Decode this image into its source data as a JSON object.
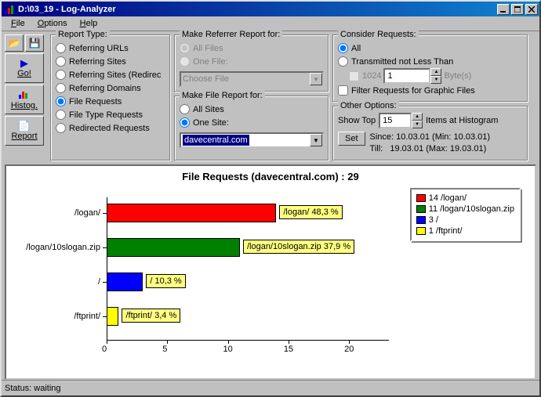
{
  "window": {
    "title": "D:\\03_19 - Log-Analyzer"
  },
  "menu": {
    "file": "File",
    "options": "Options",
    "help": "Help"
  },
  "sidebar": {
    "go": "Go!",
    "histog": "Histog.",
    "report": "Report"
  },
  "report_type": {
    "title": "Report Type:",
    "opts": [
      "Referring URLs",
      "Referring Sites",
      "Referring Sites (Redirec",
      "Referring Domains",
      "File Requests",
      "File Type Requests",
      "Redirected Requests"
    ],
    "selected": 4
  },
  "referrer_report": {
    "title": "Make Referrer Report for:",
    "all_files": "All Files",
    "one_file": "One File:",
    "choose_file": "Choose File"
  },
  "file_report": {
    "title": "Make File Report for:",
    "all_sites": "All Sites",
    "one_site": "One Site:",
    "site_value": "davecentral.com"
  },
  "consider": {
    "title": "Consider Requests:",
    "all": "All",
    "transmitted": "Transmitted not Less Than",
    "kb_value": "1024",
    "multiplier": "1",
    "bytes": "Byte(s)",
    "filter": "Filter Requests for Graphic Files"
  },
  "other": {
    "title": "Other Options:",
    "show_top": "Show Top",
    "show_top_value": "15",
    "items_at": "Items at Histogram",
    "set": "Set",
    "since_label": "Since:",
    "since_value": "10.03.01 (Min: 10.03.01)",
    "till_label": "Till:",
    "till_value": "19.03.01 (Max: 19.03.01)"
  },
  "chart_data": {
    "type": "bar",
    "title": "File Requests (davecentral.com) : 29",
    "categories": [
      "/logan/",
      "/logan/10slogan.zip",
      "/",
      "/ftprint/"
    ],
    "values": [
      14,
      11,
      3,
      1
    ],
    "percents": [
      "48,3 %",
      "37,9 %",
      "10,3 %",
      "3,4 %"
    ],
    "data_labels": [
      "/logan/ 48,3 %",
      "/logan/10slogan.zip 37,9 %",
      "/ 10,3 %",
      "/ftprint/ 3,4 %"
    ],
    "xlim": [
      0,
      22
    ],
    "xticks": [
      0,
      5,
      10,
      15,
      20
    ],
    "colors": [
      "#ff0000",
      "#008000",
      "#0000ff",
      "#ffff00"
    ],
    "legend": [
      "14 /logan/",
      "11 /logan/10slogan.zip",
      "3 /",
      "1 /ftprint/"
    ]
  },
  "status": {
    "text": "Status: waiting"
  }
}
